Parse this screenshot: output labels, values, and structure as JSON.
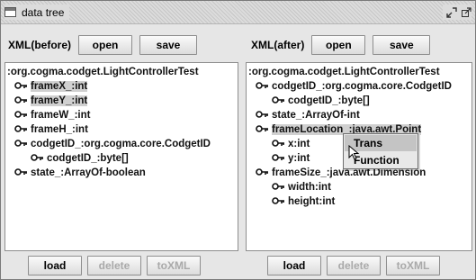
{
  "window": {
    "title": "data tree",
    "buttons": [
      "restore",
      "maximize"
    ]
  },
  "left": {
    "label": "XML(before)",
    "open_label": "open",
    "save_label": "save",
    "tree": [
      {
        "text": ":org.cogma.codget.LightControllerTest",
        "icon": false,
        "highlighted": false
      },
      {
        "text": "frameX_:int",
        "icon": true,
        "highlighted": true
      },
      {
        "text": "frameY_:int",
        "icon": true,
        "highlighted": true
      },
      {
        "text": "frameW_:int",
        "icon": true,
        "highlighted": false
      },
      {
        "text": "frameH_:int",
        "icon": true,
        "highlighted": false
      },
      {
        "text": "codgetID_:org.cogma.core.CodgetID",
        "icon": true,
        "highlighted": false
      },
      {
        "text": "codgetID_:byte[]",
        "icon": true,
        "highlighted": false
      },
      {
        "text": "state_:ArrayOf-boolean",
        "icon": true,
        "highlighted": false
      }
    ],
    "bottom": {
      "load": "load",
      "delete": "delete",
      "toXML": "toXML"
    }
  },
  "right": {
    "label": "XML(after)",
    "open_label": "open",
    "save_label": "save",
    "tree": [
      {
        "text": ":org.cogma.codget.LightControllerTest",
        "icon": false,
        "highlighted": false
      },
      {
        "text": "codgetID_:org.cogma.core.CodgetID",
        "icon": true,
        "highlighted": false
      },
      {
        "text": "codgetID_:byte[]",
        "icon": true,
        "highlighted": false
      },
      {
        "text": "state_:ArrayOf-int",
        "icon": true,
        "highlighted": false
      },
      {
        "text": "frameLocation_:java.awt.Point",
        "icon": true,
        "highlighted": true
      },
      {
        "text": "x:int",
        "icon": true,
        "highlighted": false
      },
      {
        "text": "y:int",
        "icon": true,
        "highlighted": false
      },
      {
        "text": "frameSize_:java.awt.Dimension",
        "icon": true,
        "highlighted": false
      },
      {
        "text": "width:int",
        "icon": true,
        "highlighted": false
      },
      {
        "text": "height:int",
        "icon": true,
        "highlighted": false
      }
    ],
    "bottom": {
      "load": "load",
      "delete": "delete",
      "toXML": "toXML"
    }
  },
  "context_menu": {
    "items": [
      "Trans",
      "Function"
    ],
    "selected": "Trans"
  },
  "colors": {
    "background": "#e6e6e6",
    "highlight": "#d0d0d0",
    "menu_selected": "#c4c4c4",
    "disabled_text": "#a9a9a9"
  }
}
